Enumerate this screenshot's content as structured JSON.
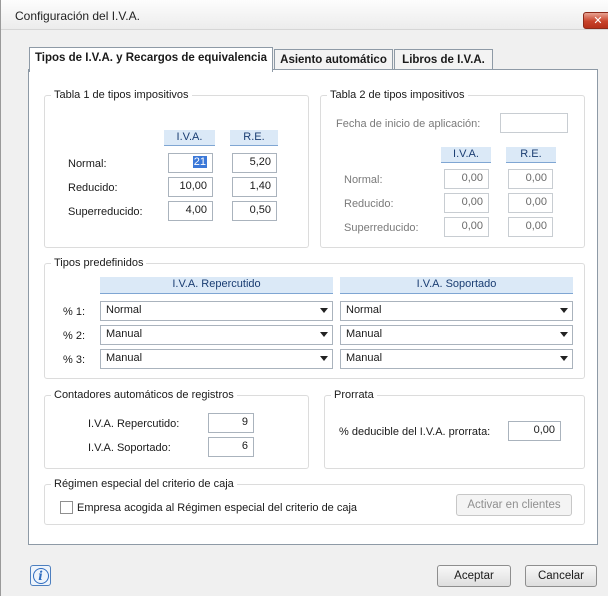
{
  "window": {
    "title": "Configuración del I.V.A.",
    "close_glyph": "✕"
  },
  "tabs": [
    {
      "label": "Tipos de I.V.A. y Recargos de equivalencia"
    },
    {
      "label": "Asiento automático"
    },
    {
      "label": "Libros de I.V.A."
    }
  ],
  "tabla1": {
    "title": "Tabla 1 de tipos impositivos",
    "col_iva": "I.V.A.",
    "col_re": "R.E.",
    "rows": [
      {
        "label": "Normal:",
        "iva": "21",
        "re": "5,20"
      },
      {
        "label": "Reducido:",
        "iva": "10,00",
        "re": "1,40"
      },
      {
        "label": "Superreducido:",
        "iva": "4,00",
        "re": "0,50"
      }
    ]
  },
  "tabla2": {
    "title": "Tabla 2 de tipos impositivos",
    "fecha_label": "Fecha de inicio de aplicación:",
    "fecha_value": "",
    "col_iva": "I.V.A.",
    "col_re": "R.E.",
    "rows": [
      {
        "label": "Normal:",
        "iva": "0,00",
        "re": "0,00"
      },
      {
        "label": "Reducido:",
        "iva": "0,00",
        "re": "0,00"
      },
      {
        "label": "Superreducido:",
        "iva": "0,00",
        "re": "0,00"
      }
    ]
  },
  "predefinidos": {
    "title": "Tipos predefinidos",
    "col_repercutido": "I.V.A. Repercutido",
    "col_soportado": "I.V.A. Soportado",
    "rows": [
      {
        "label": "% 1:",
        "repercutido": "Normal",
        "soportado": "Normal"
      },
      {
        "label": "% 2:",
        "repercutido": "Manual",
        "soportado": "Manual"
      },
      {
        "label": "% 3:",
        "repercutido": "Manual",
        "soportado": "Manual"
      }
    ]
  },
  "contadores": {
    "title": "Contadores automáticos de registros",
    "repercutido_label": "I.V.A. Repercutido:",
    "repercutido_value": "9",
    "soportado_label": "I.V.A. Soportado:",
    "soportado_value": "6"
  },
  "prorrata": {
    "title": "Prorrata",
    "label": "% deducible del I.V.A. prorrata:",
    "value": "0,00"
  },
  "regimen": {
    "title": "Régimen especial del criterio de caja",
    "checkbox_label": "Empresa acogida al Régimen especial del criterio de caja",
    "checked": false,
    "activar_label": "Activar en clientes"
  },
  "footer": {
    "aceptar_label": "Aceptar",
    "cancelar_label": "Cancelar",
    "info_icon": "info-icon"
  },
  "colors": {
    "header_bg": "#dbe9f7",
    "header_text": "#1a3d72",
    "accent": "#3b78d8"
  }
}
